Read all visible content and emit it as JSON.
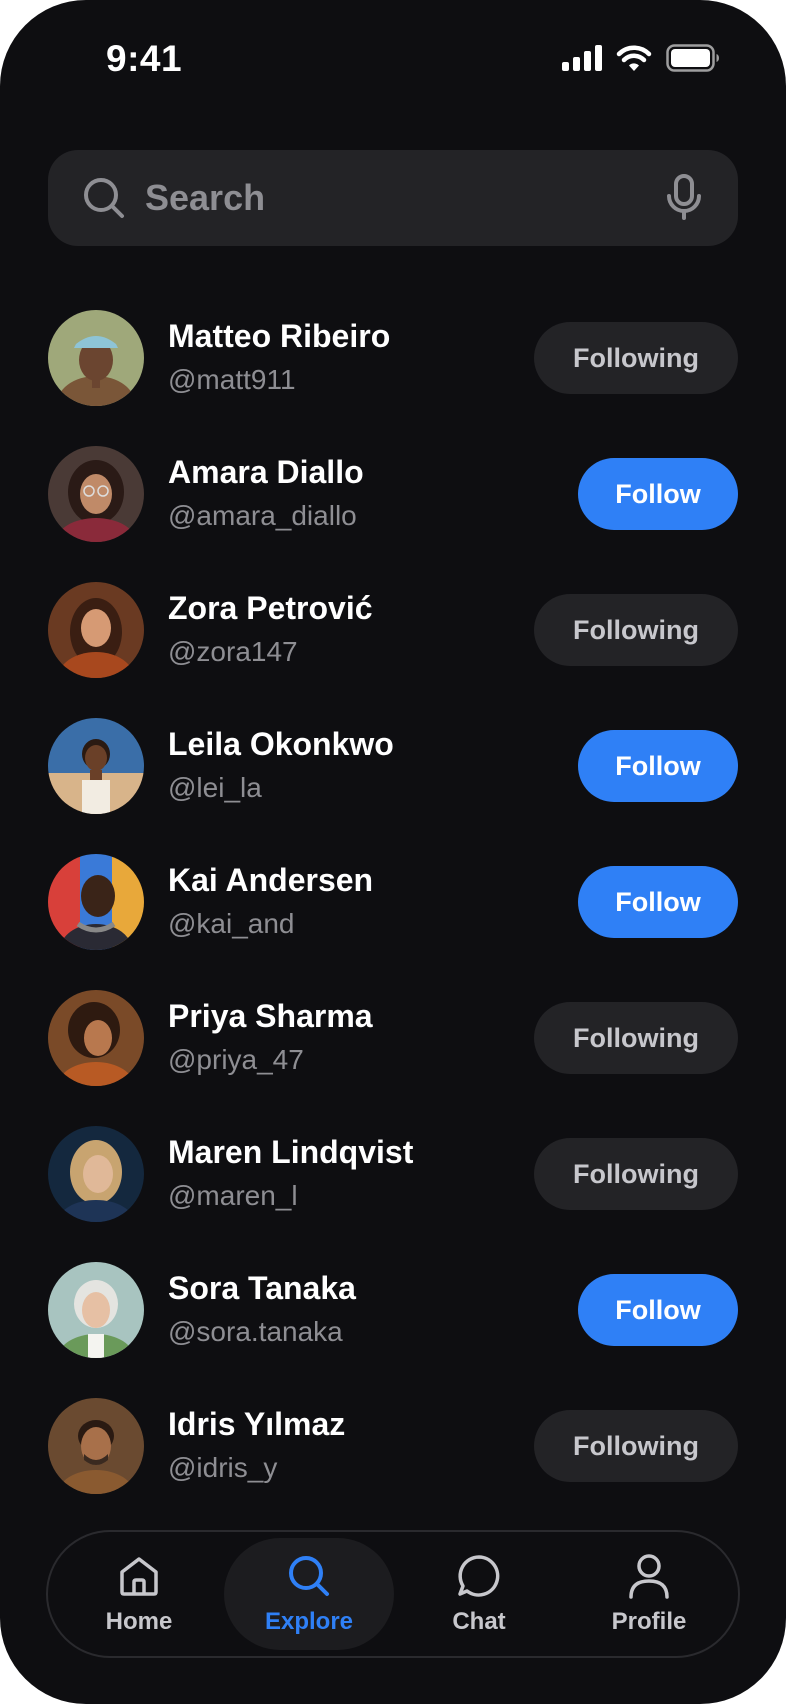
{
  "status_bar": {
    "time": "9:41"
  },
  "search": {
    "placeholder": "Search"
  },
  "users": [
    {
      "name": "Matteo Ribeiro",
      "handle": "@matt911",
      "button": "Following",
      "state": "following"
    },
    {
      "name": "Amara Diallo",
      "handle": "@amara_diallo",
      "button": "Follow",
      "state": "follow"
    },
    {
      "name": "Zora Petrović",
      "handle": "@zora147",
      "button": "Following",
      "state": "following"
    },
    {
      "name": "Leila Okonkwo",
      "handle": "@lei_la",
      "button": "Follow",
      "state": "follow"
    },
    {
      "name": "Kai Andersen",
      "handle": "@kai_and",
      "button": "Follow",
      "state": "follow"
    },
    {
      "name": "Priya Sharma",
      "handle": "@priya_47",
      "button": "Following",
      "state": "following"
    },
    {
      "name": "Maren Lindqvist",
      "handle": "@maren_l",
      "button": "Following",
      "state": "following"
    },
    {
      "name": "Sora Tanaka",
      "handle": "@sora.tanaka",
      "button": "Follow",
      "state": "follow"
    },
    {
      "name": "Idris Yılmaz",
      "handle": "@idris_y",
      "button": "Following",
      "state": "following"
    }
  ],
  "tab_bar": {
    "tabs": [
      {
        "label": "Home",
        "icon": "home-icon"
      },
      {
        "label": "Explore",
        "icon": "search-icon",
        "active": true
      },
      {
        "label": "Chat",
        "icon": "chat-bubble-icon"
      },
      {
        "label": "Profile",
        "icon": "person-icon"
      }
    ]
  },
  "colors": {
    "background": "#0e0e11",
    "surface": "#232326",
    "accent": "#2f80f6",
    "text_primary": "#ffffff",
    "text_secondary": "#8e8e93"
  }
}
